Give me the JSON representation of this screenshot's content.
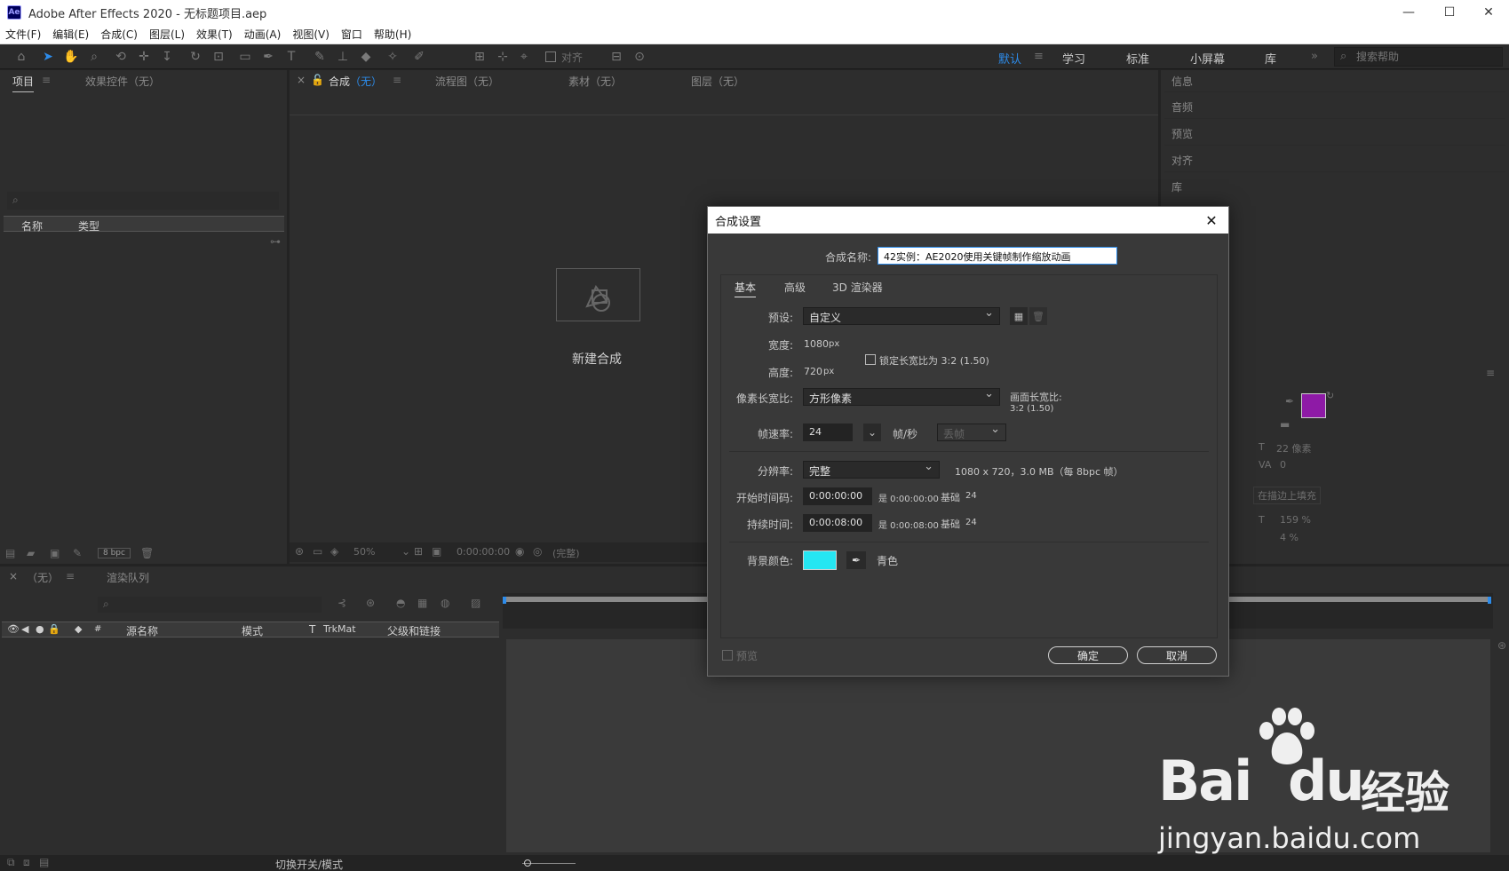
{
  "window": {
    "app_badge": "Ae",
    "title": "Adobe After Effects 2020 - 无标题项目.aep",
    "minimize": "—",
    "maximize": "☐",
    "close": "✕"
  },
  "menu": [
    "文件(F)",
    "编辑(E)",
    "合成(C)",
    "图层(L)",
    "效果(T)",
    "动画(A)",
    "视图(V)",
    "窗口",
    "帮助(H)"
  ],
  "toolbar": {
    "snap_label": "对齐",
    "workspaces": [
      "默认",
      "学习",
      "标准",
      "小屏幕",
      "库"
    ],
    "active_workspace": "默认",
    "more": "»",
    "search_placeholder": "搜索帮助"
  },
  "project_panel": {
    "tabs": [
      "项目",
      "效果控件（无）"
    ],
    "columns": [
      "名称",
      "类型"
    ],
    "search_icon": "⌕",
    "bpc": "8 bpc"
  },
  "comp_panel": {
    "close": "×",
    "tabs": [
      {
        "label": "合成",
        "suffix": "（无）"
      },
      {
        "label": "流程图（无）"
      },
      {
        "label": "素材（无）"
      },
      {
        "label": "图层（无）"
      }
    ],
    "new_comp_label": "新建合成",
    "zoom": "50%",
    "timecode": "0:00:00:00",
    "quality": "(完整)"
  },
  "right_panel": {
    "items": [
      "信息",
      "音频",
      "预览",
      "对齐",
      "库"
    ],
    "char": {
      "size": "22 像素",
      "tracking": "0",
      "stroke": "在描边上填充",
      "vscale": "159 %",
      "baseline": "4 %"
    },
    "fill_color": "#8e1aa6",
    "stroke_color": "#000000"
  },
  "timeline": {
    "close": "×",
    "tabs": [
      "（无）",
      "渲染队列"
    ],
    "columns": [
      "源名称",
      "模式",
      "T",
      "TrkMat",
      "父级和链接"
    ],
    "toggle_label": "切换开关/模式"
  },
  "dialog": {
    "title": "合成设置",
    "name_label": "合成名称:",
    "name_value": "42实例：AE2020使用关键帧制作缩放动画",
    "tabs": [
      "基本",
      "高级",
      "3D 渲染器"
    ],
    "preset_label": "预设:",
    "preset_value": "自定义",
    "width_label": "宽度:",
    "width_value": "1080",
    "height_label": "高度:",
    "height_value": "720",
    "px": "px",
    "lock_label": "锁定长宽比为 3:2 (1.50)",
    "pixel_aspect_label": "像素长宽比:",
    "pixel_aspect_value": "方形像素",
    "frame_aspect_label": "画面长宽比:",
    "frame_aspect_value": "3:2 (1.50)",
    "fps_label": "帧速率:",
    "fps_value": "24",
    "fps_unit": "帧/秒",
    "drop_frame": "丢帧",
    "resolution_label": "分辨率:",
    "resolution_value": "完整",
    "resolution_info": "1080 x 720，3.0 MB（每 8bpc 帧）",
    "start_label": "开始时间码:",
    "start_value": "0:00:00:00",
    "start_info": "是 0:00:00:00",
    "base_label": "基础",
    "base_value": "24",
    "duration_label": "持续时间:",
    "duration_value": "0:00:08:00",
    "duration_info": "是 0:00:08:00",
    "bg_label": "背景颜色:",
    "bg_color": "#25e6f2",
    "bg_name": "青色",
    "preview_label": "预览",
    "ok": "确定",
    "cancel": "取消"
  },
  "watermark": {
    "logo_a": "Bai",
    "logo_b": "du",
    "logo_cn": "经验",
    "url": "jingyan.baidu.com"
  }
}
